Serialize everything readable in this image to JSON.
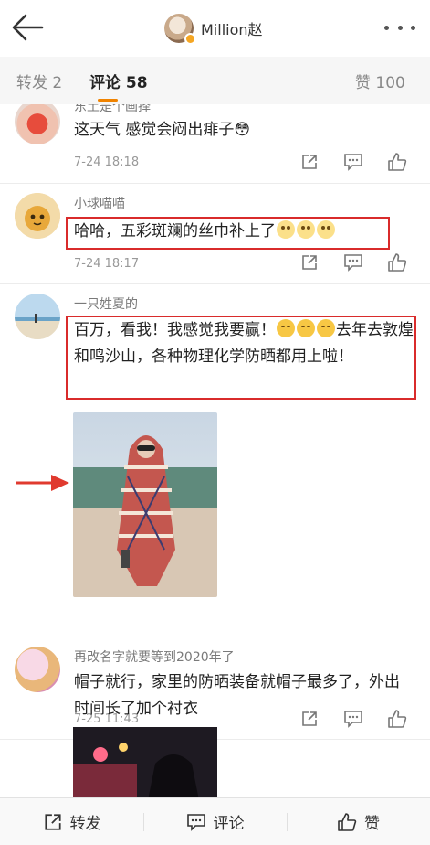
{
  "header": {
    "title": "Million赵"
  },
  "tabs": [
    {
      "label": "转发 2"
    },
    {
      "label": "评论 58"
    },
    {
      "label": "赞 100"
    }
  ],
  "comments": [
    {
      "username": "东土是个画择",
      "text": "这天气 感觉会闷出痱子😳",
      "time": "7-24 18:18"
    },
    {
      "username": "小球喵喵",
      "text": "哈哈，五彩斑斓的丝巾补上了",
      "time": "7-24 18:17"
    },
    {
      "username": "一只姓夏的",
      "text": "百万，看我！我感觉我要赢！",
      "text_after_emoji": "去年去敦煌和鸣沙山，各种物理化学防晒都用上啦！",
      "time": "7-25 11:43"
    },
    {
      "username": "再改名字就要等到2020年了",
      "text": "帽子就行，家里的防晒装备就帽子最多了，外出时间长了加个衬衣"
    }
  ],
  "bottom_bar": {
    "repost": "转发",
    "comment": "评论",
    "like": "赞"
  },
  "colors": {
    "accent": "#f08300",
    "highlight": "#d92b2b"
  }
}
